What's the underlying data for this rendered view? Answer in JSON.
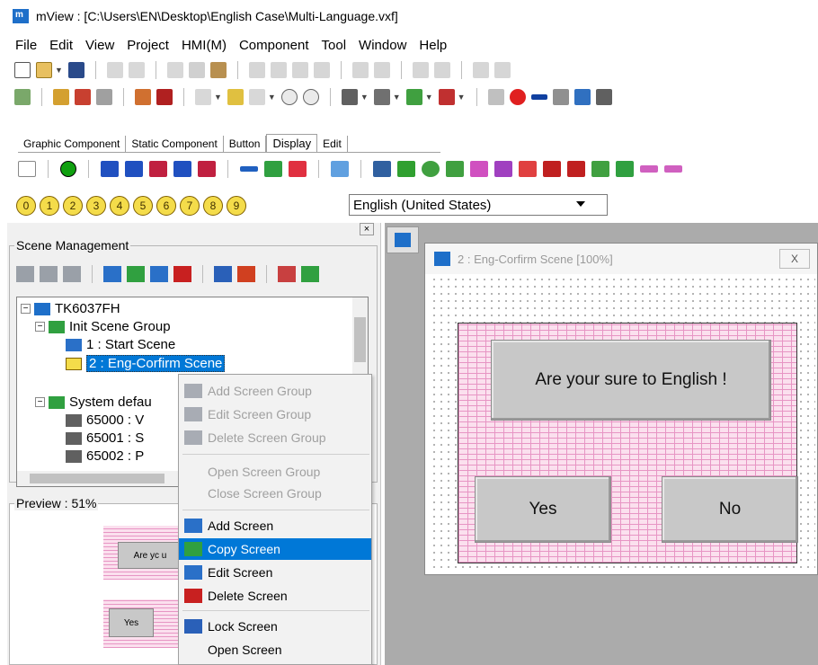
{
  "window": {
    "title": "mView : [C:\\Users\\EN\\Desktop\\English Case\\Multi-Language.vxf]"
  },
  "menu": [
    "File",
    "Edit",
    "View",
    "Project",
    "HMI(M)",
    "Component",
    "Tool",
    "Window",
    "Help"
  ],
  "component_tabs": [
    "Graphic Component",
    "Static Component",
    "Button",
    "Display",
    "Edit"
  ],
  "active_tab": "Display",
  "number_buttons": [
    "0",
    "1",
    "2",
    "3",
    "4",
    "5",
    "6",
    "7",
    "8",
    "9"
  ],
  "language": {
    "selected": "English (United States)"
  },
  "scene_management": {
    "title": "Scene Management",
    "tree": {
      "root": "TK6037FH",
      "group1": "Init Scene Group",
      "item1": "1 : Start Scene",
      "item2": "2 : Eng-Corfirm Scene",
      "group2": "System defau",
      "sys1": "65000 : V",
      "sys2": "65001 : S",
      "sys3": "65002 : P"
    }
  },
  "preview": {
    "title": "Preview : 51%",
    "button_top": "Are yc u",
    "button_bottom": "Yes"
  },
  "context_menu": {
    "items": [
      "Add Screen Group",
      "Edit Screen Group",
      "Delete Screen Group",
      "Open Screen Group",
      "Close Screen Group",
      "Add Screen",
      "Copy Screen",
      "Edit Screen",
      "Delete Screen",
      "Lock Screen",
      "Open Screen"
    ],
    "highlighted": "Copy Screen"
  },
  "scene_window": {
    "title": "2 : Eng-Corfirm Scene [100%]",
    "close": "X",
    "prompt_button": "Are your sure to English !",
    "yes_button": "Yes",
    "no_button": "No"
  }
}
